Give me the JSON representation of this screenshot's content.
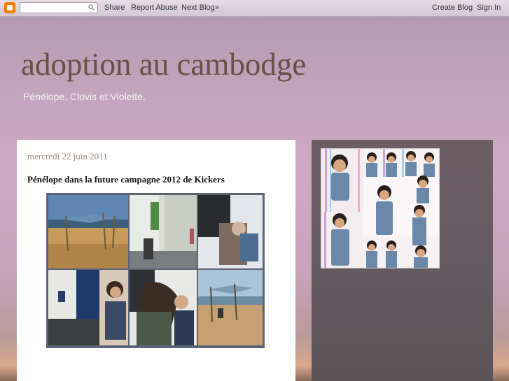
{
  "navbar": {
    "share": "Share",
    "report_abuse": "Report Abuse",
    "next_blog": "Next Blog»",
    "create_blog": "Create Blog",
    "sign_in": "Sign In",
    "search_placeholder": ""
  },
  "header": {
    "title": "adoption au cambodge",
    "description": "Pénélope, Clovis et Violette."
  },
  "post": {
    "date": "mercredi 22 juin 2011",
    "title": "Pénélope dans la future campagne 2012 de Kickers"
  },
  "icons": {
    "logo": "blogger-logo-icon",
    "search": "search-icon"
  },
  "colors": {
    "title": "#6b4f47",
    "logo": "#f57d00"
  }
}
